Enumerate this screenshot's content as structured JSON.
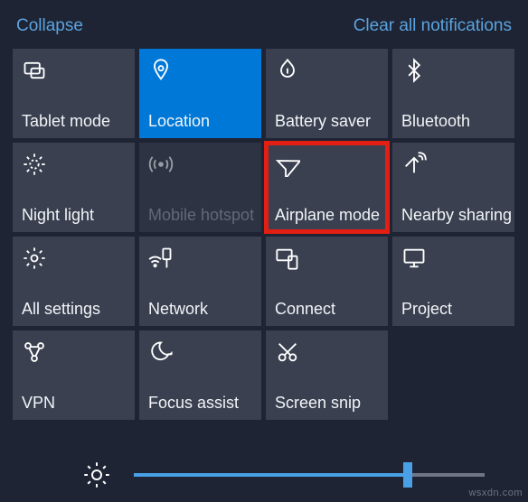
{
  "header": {
    "collapse": "Collapse",
    "clear": "Clear all notifications"
  },
  "tiles": [
    {
      "label": "Tablet mode",
      "icon": "tablet-mode-icon",
      "active": false,
      "disabled": false,
      "highlight": false
    },
    {
      "label": "Location",
      "icon": "location-icon",
      "active": true,
      "disabled": false,
      "highlight": false
    },
    {
      "label": "Battery saver",
      "icon": "battery-saver-icon",
      "active": false,
      "disabled": false,
      "highlight": false
    },
    {
      "label": "Bluetooth",
      "icon": "bluetooth-icon",
      "active": false,
      "disabled": false,
      "highlight": false
    },
    {
      "label": "Night light",
      "icon": "night-light-icon",
      "active": false,
      "disabled": false,
      "highlight": false
    },
    {
      "label": "Mobile hotspot",
      "icon": "hotspot-icon",
      "active": false,
      "disabled": true,
      "highlight": false
    },
    {
      "label": "Airplane mode",
      "icon": "airplane-icon",
      "active": false,
      "disabled": false,
      "highlight": true
    },
    {
      "label": "Nearby sharing",
      "icon": "nearby-share-icon",
      "active": false,
      "disabled": false,
      "highlight": false
    },
    {
      "label": "All settings",
      "icon": "gear-icon",
      "active": false,
      "disabled": false,
      "highlight": false
    },
    {
      "label": "Network",
      "icon": "network-icon",
      "active": false,
      "disabled": false,
      "highlight": false
    },
    {
      "label": "Connect",
      "icon": "connect-icon",
      "active": false,
      "disabled": false,
      "highlight": false
    },
    {
      "label": "Project",
      "icon": "project-icon",
      "active": false,
      "disabled": false,
      "highlight": false
    },
    {
      "label": "VPN",
      "icon": "vpn-icon",
      "active": false,
      "disabled": false,
      "highlight": false
    },
    {
      "label": "Focus assist",
      "icon": "focus-assist-icon",
      "active": false,
      "disabled": false,
      "highlight": false
    },
    {
      "label": "Screen snip",
      "icon": "screen-snip-icon",
      "active": false,
      "disabled": false,
      "highlight": false
    }
  ],
  "brightness": {
    "value": 78
  },
  "colors": {
    "background": "#1e2433",
    "tile": "#3a4050",
    "tile_active": "#0078d7",
    "link": "#5aa3e0",
    "highlight_outline": "#e21f12",
    "slider_accent": "#4aa0e6"
  },
  "watermark": "wsxdn.com"
}
